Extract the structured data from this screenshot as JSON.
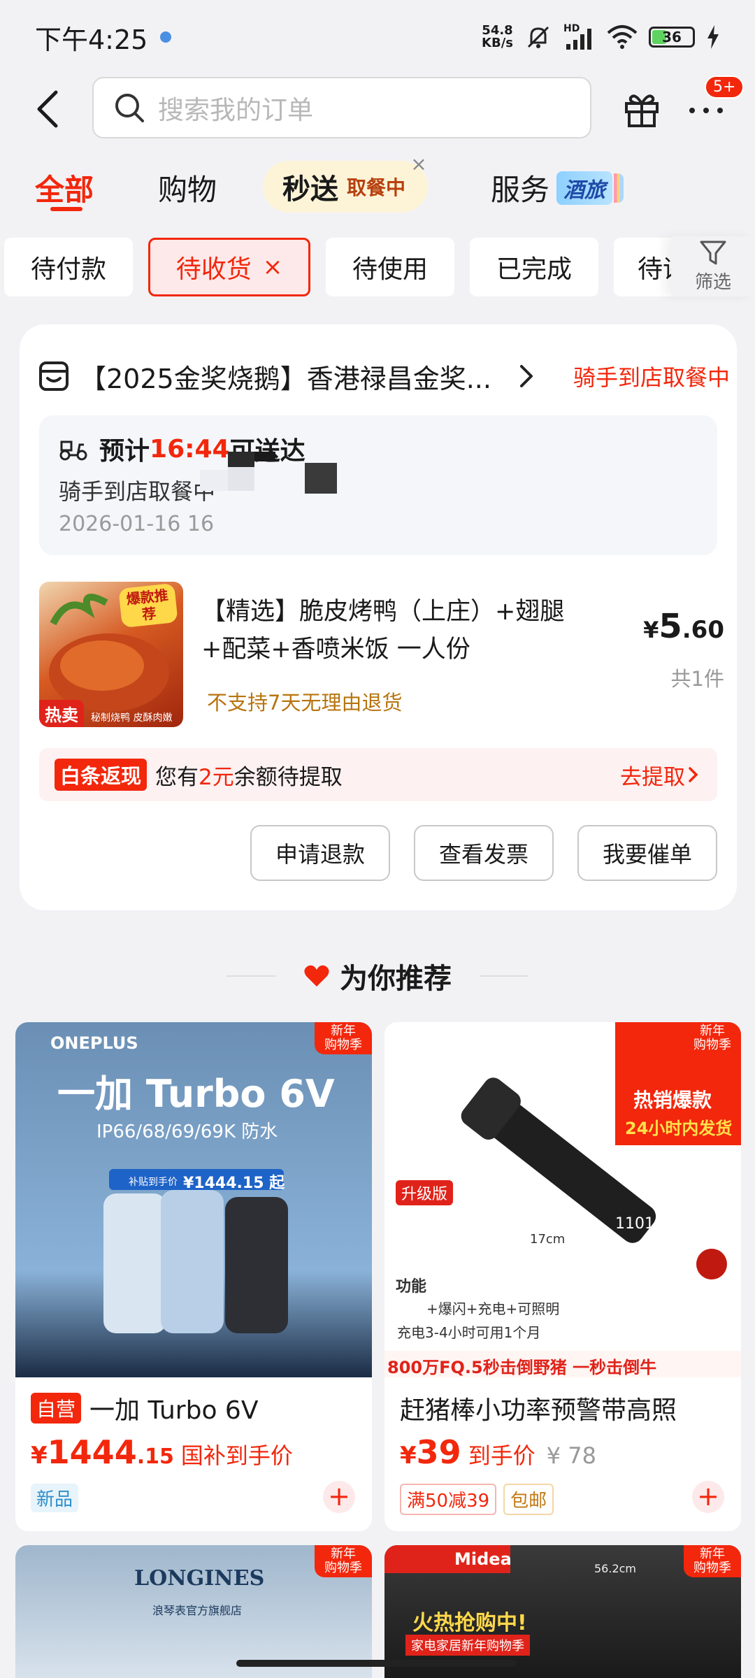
{
  "status_bar": {
    "time": "下午4:25",
    "net_speed_value": "54.8",
    "net_speed_unit": "KB/s",
    "signal_label": "HD",
    "battery": "36",
    "battery_level": 0.36
  },
  "header": {
    "search_placeholder": "搜索我的订单",
    "badge": "5+"
  },
  "tabs": {
    "all": "全部",
    "shopping": "购物",
    "flash": "秒送",
    "flash_status": "取餐中",
    "service": "服务",
    "service_tag": "酒旅"
  },
  "filters": [
    "待付款",
    "待收货",
    "待使用",
    "已完成",
    "待评"
  ],
  "filter_label": "筛选",
  "order": {
    "store_name": "【2025金奖烧鹅】香港禄昌金奖...",
    "status": "骑手到店取餐中",
    "eta_prefix": "预计",
    "eta_time": "16:44",
    "eta_suffix": "可送达",
    "eta_sub": "骑手到店取餐中",
    "eta_date": "2026-01-16 16",
    "product": {
      "img_tag": "热卖",
      "img_sub": "秘制烧鸭 皮酥肉嫩",
      "img_badge": "爆款推荐",
      "title": "【精选】脆皮烤鸭（上庄）+翅腿+配菜+香喷米饭 一人份",
      "note": "不支持7天无理由退货",
      "price_symbol": "¥",
      "price_int": "5",
      "price_dec": ".60",
      "qty": "共1件"
    },
    "cashback": {
      "tag": "白条返现",
      "text_pre": "您有",
      "amount": "2元",
      "text_post": "余额待提取",
      "link": "去提取"
    },
    "actions": [
      "申请退款",
      "查看发票",
      "我要催单"
    ]
  },
  "recommend": {
    "title": "为你推荐",
    "new_tag_line1": "新年",
    "new_tag_line2": "购物季",
    "items": [
      {
        "tag": "自营",
        "name": "一加 Turbo 6V",
        "price_symbol": "¥",
        "price_int": "1444",
        "price_dec": ".15",
        "price_desc": "国补到手价",
        "labels": [
          "新品"
        ],
        "img_brand": "ONEPLUS",
        "img_title": "一加 Turbo 6V",
        "img_sub": "IP66/68/69/69K 防水",
        "img_price_label": "补贴到手价",
        "img_price": "¥1444.15 起"
      },
      {
        "name": "赶猪棒小功率预警带高照",
        "price_symbol": "¥",
        "price_int": "39",
        "price_desc": "到手价",
        "orig_price": "¥ 78",
        "labels": [
          "满50减39",
          "包邮"
        ],
        "img_hot": "热销爆款",
        "img_ship": "24小时内发货",
        "img_upgrade": "升级版",
        "img_func": "功能",
        "img_func_detail": "+爆闪+充电+可照明",
        "img_charge": "充电3-4小时可用1个月",
        "img_slogan": "800万FQ.5秒击倒野猪 一秒击倒牛",
        "img_model": "1101",
        "img_size": "17cm"
      }
    ],
    "next_left_brand": "LONGINES",
    "next_left_sub": "浪琴表官方旗舰店",
    "next_right_brand": "Midea",
    "next_right_banner": "火热抢购中!",
    "next_right_sub": "家电家居新年购物季",
    "next_right_size": "56.2cm"
  }
}
